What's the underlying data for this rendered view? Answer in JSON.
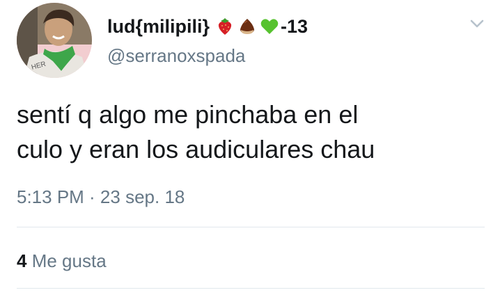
{
  "tweet": {
    "display_name": "lud{milipili}",
    "name_emojis": [
      "strawberry-emoji",
      "chestnut-emoji",
      "green-heart-emoji"
    ],
    "name_suffix": "-13",
    "handle": "@serranoxspada",
    "text_lines": [
      "sentí q algo me pinchaba en el",
      "culo y eran los audiculares chau"
    ],
    "timestamp": "5:13 PM · 23 sep. 18",
    "likes_count": "4",
    "likes_label": "Me gusta"
  },
  "icons": {
    "menu": "chevron-down-icon"
  },
  "colors": {
    "primary_text": "#14171a",
    "secondary_text": "#657786",
    "divider": "#e1e8ed",
    "green_heart": "#57c22f",
    "strawberry": "#d61f26"
  }
}
